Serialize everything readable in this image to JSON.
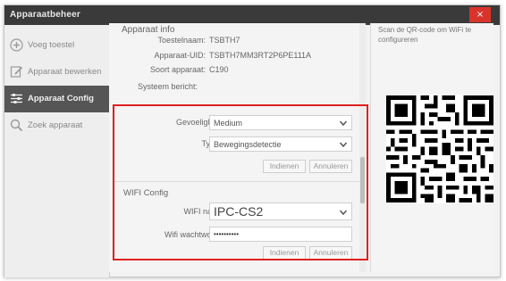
{
  "window": {
    "title": "Apparaatbeheer",
    "close_glyph": "×"
  },
  "sidebar": {
    "items": [
      {
        "label": "Voeg toestel",
        "icon": "plus-circle-icon",
        "active": false
      },
      {
        "label": "Apparaat bewerken",
        "icon": "edit-icon",
        "active": false
      },
      {
        "label": "Apparaat Config",
        "icon": "sliders-icon",
        "active": true
      },
      {
        "label": "Zoek apparaat",
        "icon": "search-icon",
        "active": false
      }
    ]
  },
  "info": {
    "title": "Apparaat info",
    "device_name_label": "Toestelnaam:",
    "device_name_value": "TSBTH7",
    "uid_label": "Apparaat-UID:",
    "uid_value": "TSBTH7MM3RT2P6PE111A",
    "type_label": "Soort apparaat:",
    "type_value": "C190",
    "system_message_label": "Systeem bericht:"
  },
  "detection": {
    "sensitivity_label": "Gevoeligheid:",
    "sensitivity_value": "Medium",
    "types_label": "Types:",
    "types_value": "Bewegingsdetectie",
    "submit_label": "Indienen",
    "cancel_label": "Annuleren"
  },
  "wifi": {
    "section_title": "WIFI Config",
    "name_label": "WIFI naam:",
    "name_value": "IPC-CS2",
    "password_label": "Wifi wachtwoord:",
    "password_value": "••••••••••",
    "submit_label": "Indienen",
    "cancel_label": "Annuleren"
  },
  "qr": {
    "instruction": "Scan de QR-code om WiFi te configureren"
  },
  "colors": {
    "titlebar": "#3a3a3a",
    "close": "#d9342b",
    "active_nav": "#555555",
    "highlight": "#e02020"
  }
}
